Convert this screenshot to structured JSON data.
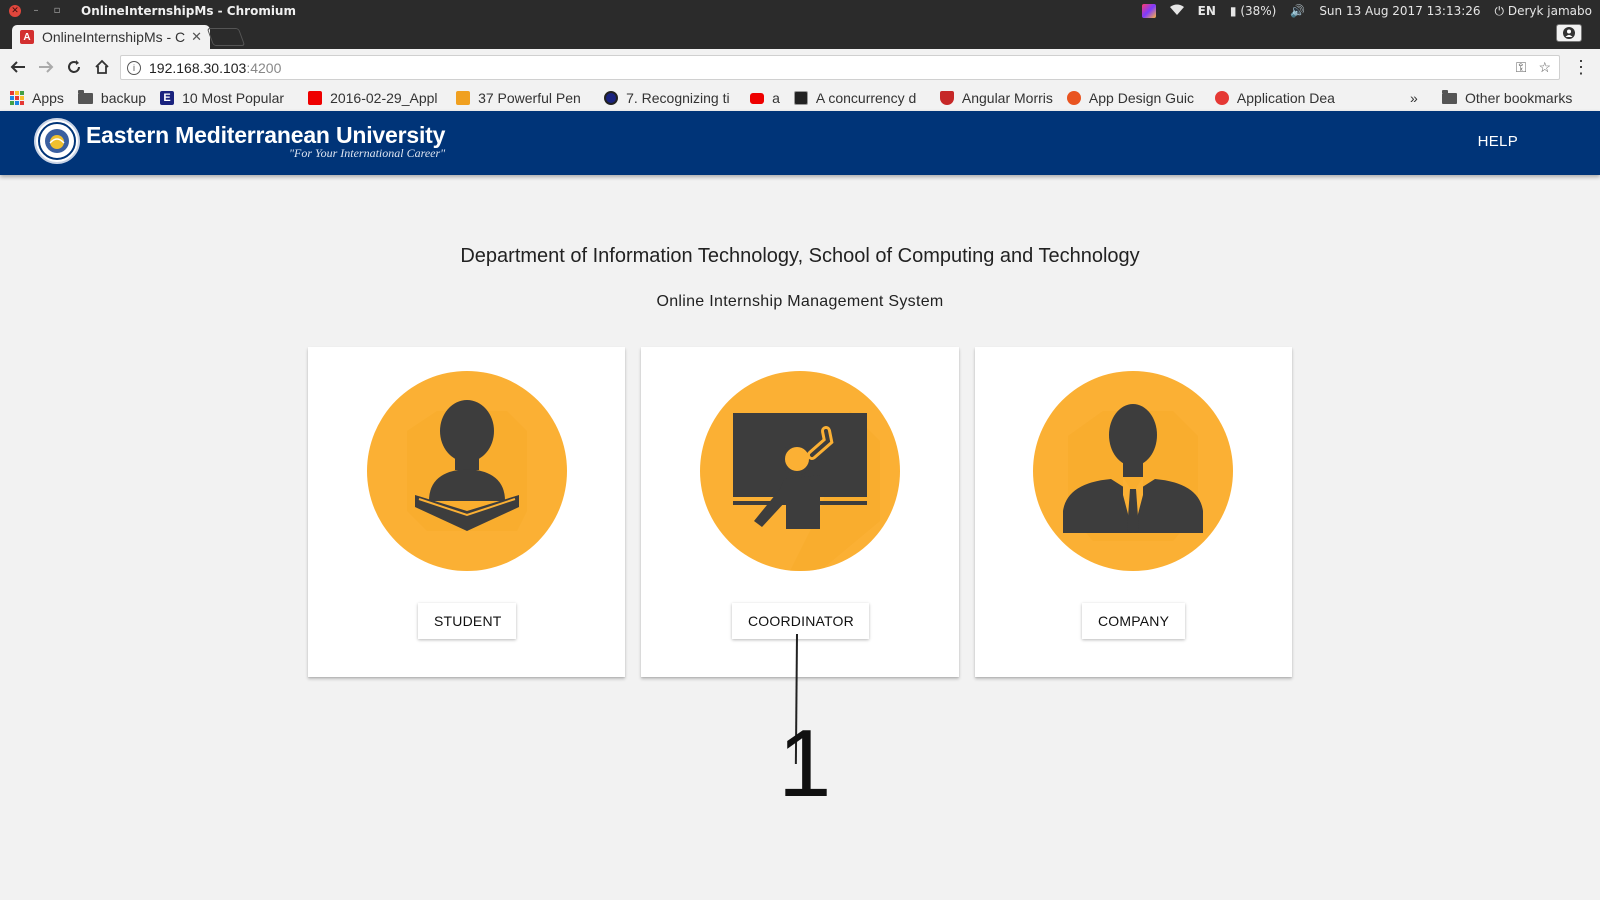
{
  "os_bar": {
    "window_title": "OnlineInternshipMs - Chromium",
    "keyboard_layout": "EN",
    "battery": "(38%)",
    "datetime": "Sun 13 Aug 2017 13:13:26",
    "user": "Deryk jamabo"
  },
  "browser": {
    "tab_title": "OnlineInternshipMs - Chromium",
    "url_host": "192.168.30.103",
    "url_port": ":4200",
    "bookmarks": [
      {
        "label": "Apps",
        "icon": "apps-grid-icon"
      },
      {
        "label": "backup",
        "icon": "folder-icon"
      },
      {
        "label": "10 Most Popular",
        "icon": "bookmark-e-icon"
      },
      {
        "label": "2016-02-29_Appl",
        "icon": "bookmark-red-icon"
      },
      {
        "label": "37 Powerful Pen",
        "icon": "bookmark-sth-icon"
      },
      {
        "label": "7. Recognizing ti",
        "icon": "bookmark-globe-icon"
      },
      {
        "label": "a",
        "icon": "youtube-icon"
      },
      {
        "label": "A concurrency d",
        "icon": "bookmark-image-icon"
      },
      {
        "label": "Angular Morris",
        "icon": "shield-icon"
      },
      {
        "label": "App Design Guic",
        "icon": "ubuntu-icon"
      },
      {
        "label": "Application Dea",
        "icon": "fan-icon"
      }
    ],
    "bookmarks_more": "»",
    "other_bookmarks": "Other bookmarks"
  },
  "header": {
    "university_name": "Eastern Mediterranean University",
    "motto": "\"For Your International Career\"",
    "help_label": "HELP"
  },
  "main": {
    "department_title": "Department of Information Technology, School of Computing and Technology",
    "system_title": "Online Internship Management System",
    "roles": [
      {
        "label": "STUDENT",
        "icon": "student-reading-icon"
      },
      {
        "label": "COORDINATOR",
        "icon": "teacher-blackboard-icon"
      },
      {
        "label": "COMPANY",
        "icon": "businessman-icon"
      }
    ]
  },
  "annotation": {
    "label": "1"
  },
  "colors": {
    "header_blue": "#003478",
    "role_orange": "#fbb034",
    "icon_dark": "#3d3d3d",
    "page_bg": "#f2f2f2"
  }
}
